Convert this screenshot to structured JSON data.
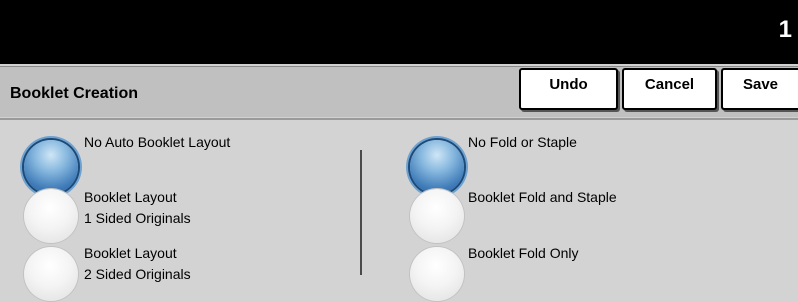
{
  "status": {
    "count": "1"
  },
  "header": {
    "title": "Booklet Creation",
    "undo_label": "Undo",
    "cancel_label": "Cancel",
    "save_label": "Save"
  },
  "layout_options": [
    {
      "line1": "No Auto Booklet Layout",
      "line2": "",
      "selected": true
    },
    {
      "line1": "Booklet Layout",
      "line2": "1 Sided Originals",
      "selected": false
    },
    {
      "line1": "Booklet Layout",
      "line2": "2 Sided Originals",
      "selected": false
    }
  ],
  "finish_options": [
    {
      "label": "No Fold or Staple",
      "selected": true
    },
    {
      "label": "Booklet Fold and Staple",
      "selected": false
    },
    {
      "label": "Booklet Fold Only",
      "selected": false
    }
  ],
  "colors": {
    "selected_radio": "#3f7bb8",
    "topbar": "#000000",
    "panel": "#d3d3d3"
  }
}
